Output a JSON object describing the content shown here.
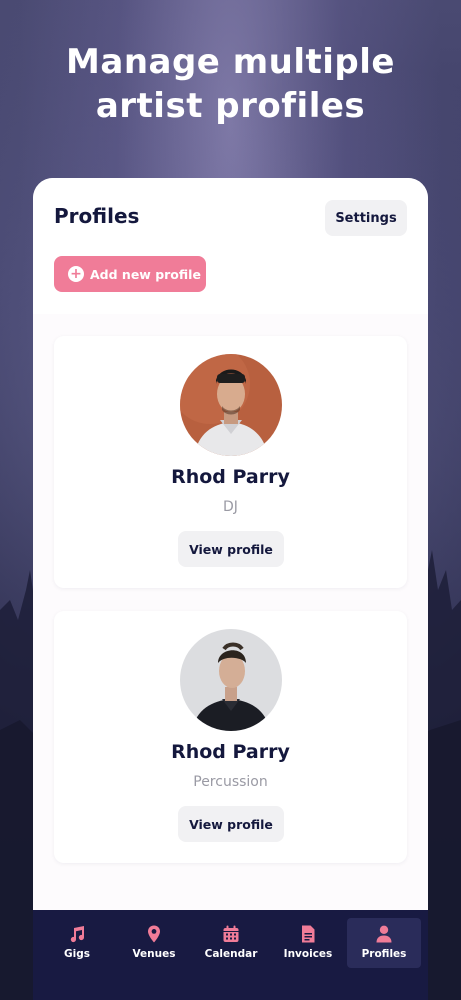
{
  "headline": {
    "line1": "Manage multiple",
    "line2": "artist profiles"
  },
  "header": {
    "title": "Profiles",
    "settings_label": "Settings",
    "add_label": "Add new profile"
  },
  "profiles": [
    {
      "name": "Rhod Parry",
      "role": "DJ",
      "view_label": "View profile"
    },
    {
      "name": "Rhod Parry",
      "role": "Percussion",
      "view_label": "View profile"
    }
  ],
  "tabs": [
    {
      "label": "Gigs",
      "icon": "music-note-icon"
    },
    {
      "label": "Venues",
      "icon": "map-pin-icon"
    },
    {
      "label": "Calendar",
      "icon": "calendar-icon"
    },
    {
      "label": "Invoices",
      "icon": "document-icon"
    },
    {
      "label": "Profiles",
      "icon": "person-icon",
      "active": true
    }
  ],
  "colors": {
    "accent": "#f07c98",
    "navy": "#14183d",
    "tabbar": "#181a42"
  }
}
